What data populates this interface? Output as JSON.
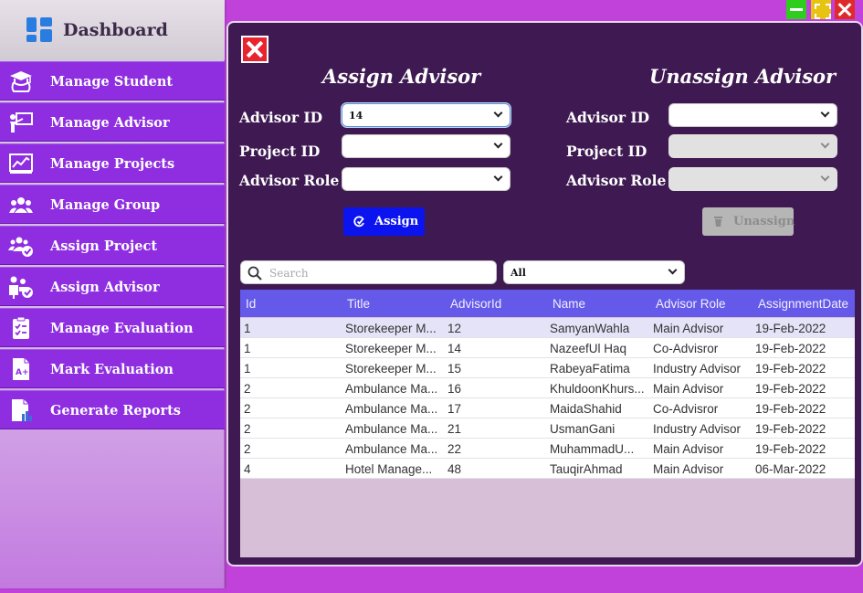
{
  "window": {
    "minimize": "minimize",
    "maximize": "maximize",
    "close": "close"
  },
  "sidebar": {
    "title": "Dashboard",
    "items": [
      {
        "label": "Manage Student",
        "icon": "graduate-icon"
      },
      {
        "label": "Manage Advisor",
        "icon": "teacher-board-icon"
      },
      {
        "label": "Manage Projects",
        "icon": "chart-presentation-icon"
      },
      {
        "label": "Manage Group",
        "icon": "group-icon"
      },
      {
        "label": "Assign Project",
        "icon": "group-check-icon"
      },
      {
        "label": "Assign Advisor",
        "icon": "person-check-icon"
      },
      {
        "label": "Manage Evaluation",
        "icon": "checklist-icon"
      },
      {
        "label": "Mark Evaluation",
        "icon": "grade-a-plus-icon"
      },
      {
        "label": "Generate Reports",
        "icon": "report-icon"
      }
    ]
  },
  "assign": {
    "title": "Assign Advisor",
    "advisor_id_label": "Advisor ID",
    "advisor_id_value": "14",
    "project_id_label": "Project ID",
    "project_id_value": "",
    "advisor_role_label": "Advisor Role",
    "advisor_role_value": "",
    "button": "Assign"
  },
  "unassign": {
    "title": "Unassign Advisor",
    "advisor_id_label": "Advisor ID",
    "project_id_label": "Project ID",
    "advisor_role_label": "Advisor Role",
    "button": "Unassign"
  },
  "search": {
    "placeholder": "Search"
  },
  "filter": {
    "value": "All"
  },
  "table": {
    "columns": [
      "Id",
      "Title",
      "AdvisorId",
      "Name",
      "Advisor Role",
      "AssignmentDate"
    ],
    "rows": [
      [
        "1",
        "Storekeeper M...",
        "12",
        "SamyanWahla",
        "Main Advisor",
        "19-Feb-2022"
      ],
      [
        "1",
        "Storekeeper M...",
        "14",
        "NazeefUl Haq",
        "Co-Advisror",
        "19-Feb-2022"
      ],
      [
        "1",
        "Storekeeper M...",
        "15",
        "RabeyaFatima",
        "Industry Advisor",
        "19-Feb-2022"
      ],
      [
        "2",
        "Ambulance Ma...",
        "16",
        "KhuldoonKhurs...",
        "Main Advisor",
        "19-Feb-2022"
      ],
      [
        "2",
        "Ambulance Ma...",
        "17",
        "MaidaShahid",
        "Co-Advisror",
        "19-Feb-2022"
      ],
      [
        "2",
        "Ambulance Ma...",
        "21",
        "UsmanGani",
        "Industry Advisor",
        "19-Feb-2022"
      ],
      [
        "2",
        "Ambulance Ma...",
        "22",
        "MuhammadU...",
        "Main Advisor",
        "19-Feb-2022"
      ],
      [
        "4",
        "Hotel Manage...",
        "48",
        "TauqirAhmad",
        "Main Advisor",
        "06-Mar-2022"
      ]
    ]
  }
}
